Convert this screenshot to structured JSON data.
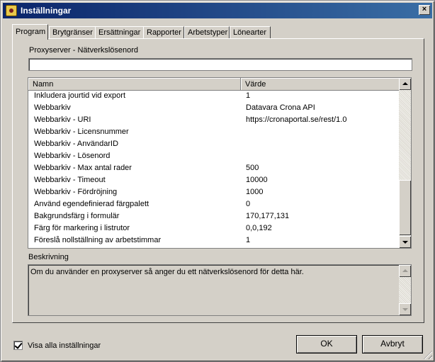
{
  "window": {
    "title": "Inställningar",
    "close_glyph": "×"
  },
  "tabs": [
    {
      "label": "Program",
      "active": true
    },
    {
      "label": "Brytgränser"
    },
    {
      "label": "Ersättningar"
    },
    {
      "label": "Rapporter"
    },
    {
      "label": "Arbetstyper"
    },
    {
      "label": "Lönearter"
    }
  ],
  "proxy_field": {
    "label": "Proxyserver - Nätverkslösenord",
    "value": ""
  },
  "grid": {
    "columns": [
      "Namn",
      "Värde"
    ],
    "rows": [
      {
        "name": "Inkludera jourtid vid export",
        "value": "1"
      },
      {
        "name": "Webbarkiv",
        "value": "Datavara Crona API"
      },
      {
        "name": "Webbarkiv - URI",
        "value": "https://cronaportal.se/rest/1.0"
      },
      {
        "name": "Webbarkiv - Licensnummer",
        "value": ""
      },
      {
        "name": "Webbarkiv - AnvändarID",
        "value": ""
      },
      {
        "name": "Webbarkiv - Lösenord",
        "value": ""
      },
      {
        "name": "Webbarkiv - Max antal rader",
        "value": "500"
      },
      {
        "name": "Webbarkiv - Timeout",
        "value": "10000"
      },
      {
        "name": "Webbarkiv - Fördröjning",
        "value": "1000"
      },
      {
        "name": "Använd egendefinierad färgpalett",
        "value": "0"
      },
      {
        "name": "Bakgrundsfärg i formulär",
        "value": "170,177,131"
      },
      {
        "name": "Färg för markering i listrutor",
        "value": "0,0,192"
      },
      {
        "name": "Föreslå nollställning av arbetstimmar",
        "value": "1"
      }
    ]
  },
  "description": {
    "label": "Beskrivning",
    "text": "Om du använder en proxyserver så anger du ett nätverkslösenord för detta här."
  },
  "show_all": {
    "label": "Visa alla inställningar",
    "checked": true
  },
  "buttons": {
    "ok": "OK",
    "cancel": "Avbryt"
  },
  "colors": {
    "titlebar_start": "#0a246a",
    "titlebar_end": "#3a6ea5",
    "face": "#d4d0c8"
  }
}
